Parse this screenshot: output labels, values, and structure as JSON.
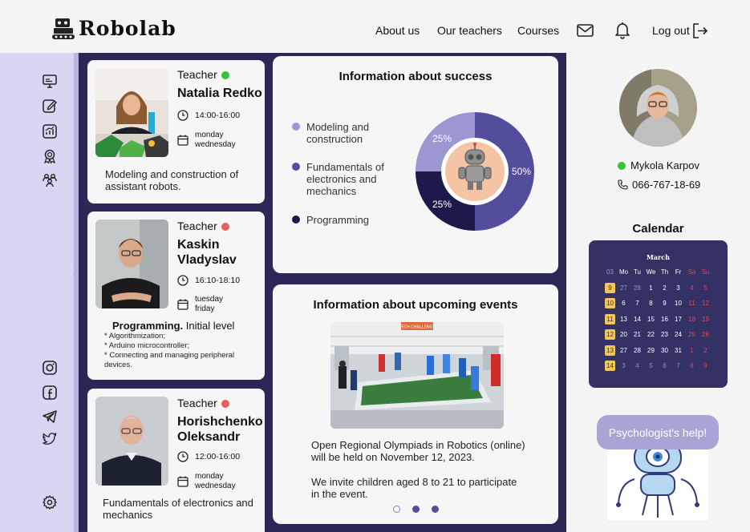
{
  "header": {
    "logo_text": "Robolab",
    "nav": [
      {
        "label": "About us"
      },
      {
        "label": "Our teachers"
      },
      {
        "label": "Courses"
      }
    ],
    "logout_label": "Log out",
    "icons": [
      "mail-icon",
      "bell-icon",
      "logout-icon"
    ]
  },
  "sidebar": {
    "icons": [
      "monitor-icon",
      "edit-icon",
      "stats-icon",
      "award-icon",
      "group-icon",
      "instagram-icon",
      "facebook-icon",
      "telegram-icon",
      "twitter-icon",
      "settings-icon",
      "chevron-right-icon"
    ]
  },
  "teachers": [
    {
      "role": "Teacher",
      "status_color": "#3cc13b",
      "name": "Natalia Redko",
      "time": "14:00-16:00",
      "days": [
        "monday",
        "wednesday"
      ],
      "description": "Modeling and construction of assistant robots."
    },
    {
      "role": "Teacher",
      "status_color": "#e85d5d",
      "name": "Kaskin Vladyslav",
      "time": "16:10-18:10",
      "days": [
        "tuesday",
        "friday"
      ],
      "course_bold": "Programming.",
      "course_level": "Initial level",
      "bullets": [
        "* Algorithmization;",
        "* Arduino microcontroller;",
        "* Connecting and managing peripheral devices."
      ]
    },
    {
      "role": "Teacher",
      "status_color": "#e85d5d",
      "name": "Horishchenko Oleksandr",
      "time": "12:00-16:00",
      "days": [
        "monday",
        "wednesday"
      ],
      "description": "Fundamentals of electronics and mechanics"
    }
  ],
  "success": {
    "title": "Information about success",
    "chart_data": {
      "type": "pie",
      "categories": [
        "Modeling and construction",
        "Fundamentals of electronics and mechanics",
        "Programming"
      ],
      "values": [
        25,
        50,
        25
      ],
      "labels": [
        "25%",
        "50%",
        "25%"
      ],
      "colors": [
        "#9b97d2",
        "#524e9c",
        "#1c1a4a"
      ]
    }
  },
  "events": {
    "title": "Information about upcoming events",
    "text1": "Open Regional Olympiads in Robotics (online) will be held on November 12, 2023.",
    "text2": "We invite children aged 8 to 21 to participate in the event.",
    "banner_text": "TECH CHALLENGE",
    "carousel_active": 0,
    "carousel_count": 3
  },
  "profile": {
    "name": "Mykola Karpov",
    "status_color": "#3cc13b",
    "phone": "066-767-18-69"
  },
  "calendar": {
    "title": "Calendar",
    "month": "March",
    "week_header": "03",
    "day_headers": [
      "Mo",
      "Tu",
      "We",
      "Th",
      "Fr",
      "Sa",
      "Su"
    ],
    "weeks": [
      {
        "num": "9",
        "days": [
          "27",
          "28",
          "1",
          "2",
          "3",
          "4",
          "5"
        ]
      },
      {
        "num": "10",
        "days": [
          "6",
          "7",
          "8",
          "9",
          "10",
          "11",
          "12"
        ]
      },
      {
        "num": "11",
        "days": [
          "13",
          "14",
          "15",
          "16",
          "17",
          "18",
          "19"
        ]
      },
      {
        "num": "12",
        "days": [
          "20",
          "21",
          "22",
          "23",
          "24",
          "25",
          "26"
        ]
      },
      {
        "num": "13",
        "days": [
          "27",
          "28",
          "29",
          "30",
          "31",
          "1",
          "2"
        ]
      },
      {
        "num": "14",
        "days": [
          "3",
          "4",
          "5",
          "6",
          "7",
          "8",
          "9"
        ]
      }
    ]
  },
  "help_button": "Psychologist's help!"
}
